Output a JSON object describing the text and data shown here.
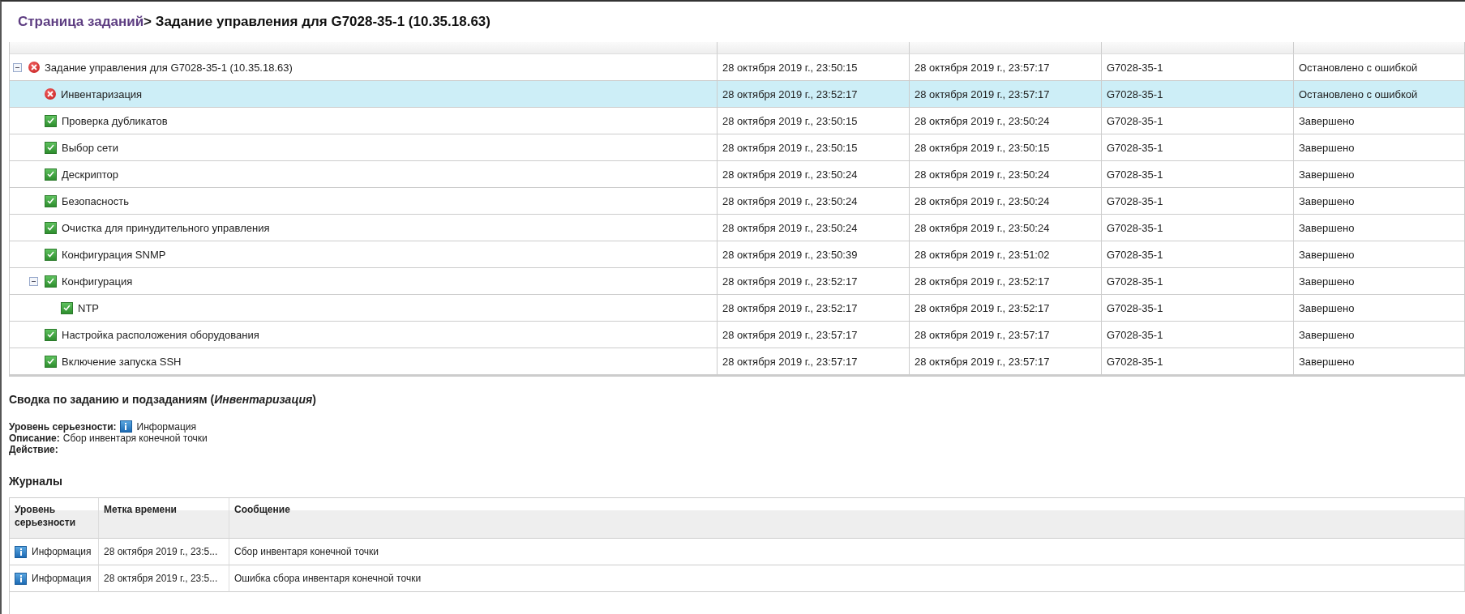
{
  "breadcrumb": {
    "link": "Страница заданий",
    "current": "> Задание управления для G7028-35-1 (10.35.18.63)"
  },
  "tree": {
    "rows": [
      {
        "name": "Задание управления для G7028-35-1 (10.35.18.63)",
        "kind": "error",
        "selected": false,
        "expanded": true,
        "cells": [
          "28 октября 2019 г., 23:50:15",
          "28 октября 2019 г., 23:57:17",
          "G7028-35-1",
          "Остановлено с ошибкой"
        ],
        "children": [
          {
            "name": "Инвентаризация",
            "kind": "error",
            "selected": true,
            "cells": [
              "28 октября 2019 г., 23:52:17",
              "28 октября 2019 г., 23:57:17",
              "G7028-35-1",
              "Остановлено с ошибкой"
            ]
          },
          {
            "name": "Проверка дубликатов",
            "kind": "ok",
            "selected": false,
            "cells": [
              "28 октября 2019 г., 23:50:15",
              "28 октября 2019 г., 23:50:24",
              "G7028-35-1",
              "Завершено"
            ]
          },
          {
            "name": "Выбор сети",
            "kind": "ok",
            "selected": false,
            "cells": [
              "28 октября 2019 г., 23:50:15",
              "28 октября 2019 г., 23:50:15",
              "G7028-35-1",
              "Завершено"
            ]
          },
          {
            "name": "Дескриптор",
            "kind": "ok",
            "selected": false,
            "cells": [
              "28 октября 2019 г., 23:50:24",
              "28 октября 2019 г., 23:50:24",
              "G7028-35-1",
              "Завершено"
            ]
          },
          {
            "name": "Безопасность",
            "kind": "ok",
            "selected": false,
            "cells": [
              "28 октября 2019 г., 23:50:24",
              "28 октября 2019 г., 23:50:24",
              "G7028-35-1",
              "Завершено"
            ]
          },
          {
            "name": "Очистка для принудительного управления",
            "kind": "ok",
            "selected": false,
            "cells": [
              "28 октября 2019 г., 23:50:24",
              "28 октября 2019 г., 23:50:24",
              "G7028-35-1",
              "Завершено"
            ]
          },
          {
            "name": "Конфигурация SNMP",
            "kind": "ok",
            "selected": false,
            "cells": [
              "28 октября 2019 г., 23:50:39",
              "28 октября 2019 г., 23:51:02",
              "G7028-35-1",
              "Завершено"
            ]
          },
          {
            "name": "Конфигурация",
            "kind": "ok",
            "selected": false,
            "expanded": true,
            "cells": [
              "28 октября 2019 г., 23:52:17",
              "28 октября 2019 г., 23:52:17",
              "G7028-35-1",
              "Завершено"
            ],
            "children": [
              {
                "name": "NTP",
                "kind": "ok",
                "selected": false,
                "cells": [
                  "28 октября 2019 г., 23:52:17",
                  "28 октября 2019 г., 23:52:17",
                  "G7028-35-1",
                  "Завершено"
                ]
              }
            ]
          },
          {
            "name": "Настройка расположения оборудования",
            "kind": "ok",
            "selected": false,
            "cells": [
              "28 октября 2019 г., 23:57:17",
              "28 октября 2019 г., 23:57:17",
              "G7028-35-1",
              "Завершено"
            ]
          },
          {
            "name": "Включение запуска SSH",
            "kind": "ok",
            "selected": false,
            "cells": [
              "28 октября 2019 г., 23:57:17",
              "28 октября 2019 г., 23:57:17",
              "G7028-35-1",
              "Завершено"
            ]
          }
        ]
      }
    ]
  },
  "summary": {
    "title": "Сводка по заданию и подзаданиям (*Инвентаризация*)",
    "fields": [
      {
        "label": "Уровень серьезности:",
        "value": "Информация",
        "kind": "info"
      },
      {
        "label": "Описание:",
        "value": "Сбор инвентаря конечной точки"
      },
      {
        "label": "Действие:"
      }
    ]
  },
  "logs": {
    "title": "Журналы",
    "columns": [
      "Уровень серьезности",
      "Метка времени",
      "Сообщение"
    ],
    "rows": [
      {
        "severity": "Информация",
        "kind": "info",
        "time": "28 октября 2019 г., 23:5...",
        "message": "Сбор инвентаря конечной точки"
      },
      {
        "severity": "Информация",
        "kind": "info",
        "time": "28 октября 2019 г., 23:5...",
        "message": "Ошибка сбора инвентаря конечной точки"
      }
    ]
  }
}
